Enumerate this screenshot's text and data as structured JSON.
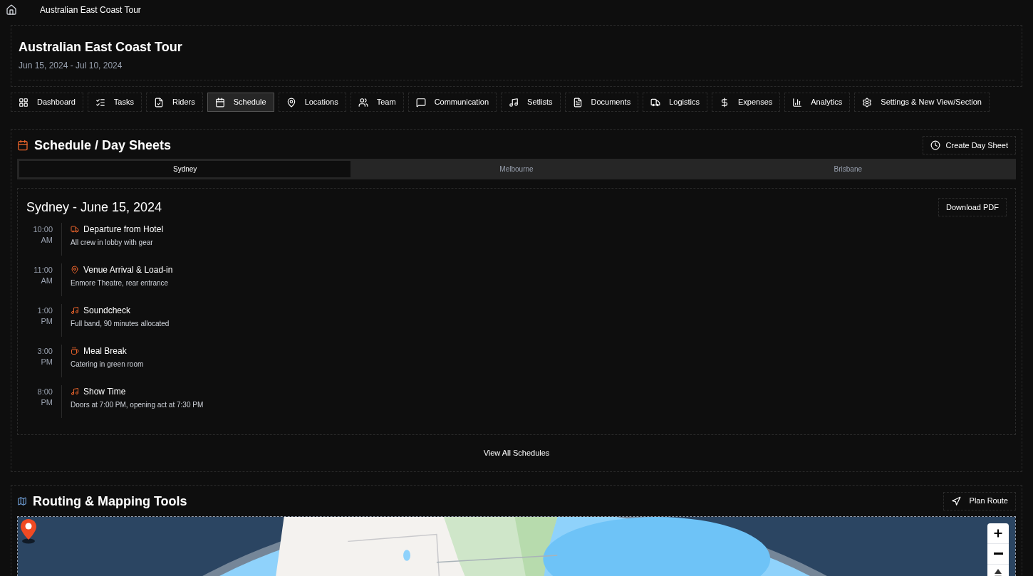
{
  "breadcrumb": {
    "title": "Australian East Coast Tour"
  },
  "header": {
    "title": "Australian East Coast Tour",
    "dates": "Jun 15, 2024 - Jul 10, 2024"
  },
  "nav_tabs": [
    {
      "label": "Dashboard",
      "selected": false
    },
    {
      "label": "Tasks",
      "selected": false
    },
    {
      "label": "Riders",
      "selected": false
    },
    {
      "label": "Schedule",
      "selected": true
    },
    {
      "label": "Locations",
      "selected": false
    },
    {
      "label": "Team",
      "selected": false
    },
    {
      "label": "Communication",
      "selected": false
    },
    {
      "label": "Setlists",
      "selected": false
    },
    {
      "label": "Documents",
      "selected": false
    },
    {
      "label": "Logistics",
      "selected": false
    },
    {
      "label": "Expenses",
      "selected": false
    },
    {
      "label": "Analytics",
      "selected": false
    },
    {
      "label": "Settings & New View/Section",
      "selected": false
    }
  ],
  "schedule": {
    "title": "Schedule / Day Sheets",
    "create_button": "Create Day Sheet",
    "city_tabs": [
      {
        "label": "Sydney",
        "selected": true
      },
      {
        "label": "Melbourne",
        "selected": false
      },
      {
        "label": "Brisbane",
        "selected": false
      }
    ],
    "day_sheet": {
      "title": "Sydney - June 15, 2024",
      "download_button": "Download PDF",
      "events": [
        {
          "time": "10:00",
          "period": "AM",
          "kind": "travel",
          "title": "Departure from Hotel",
          "note": "All crew in lobby with gear"
        },
        {
          "time": "11:00",
          "period": "AM",
          "kind": "venue",
          "title": "Venue Arrival & Load-in",
          "note": "Enmore Theatre, rear entrance"
        },
        {
          "time": "1:00",
          "period": "PM",
          "kind": "music",
          "title": "Soundcheck",
          "note": "Full band, 90 minutes allocated"
        },
        {
          "time": "3:00",
          "period": "PM",
          "kind": "meal",
          "title": "Meal Break",
          "note": "Catering in green room"
        },
        {
          "time": "8:00",
          "period": "PM",
          "kind": "music",
          "title": "Show Time",
          "note": "Doors at 7:00 PM, opening act at 7:30 PM"
        }
      ]
    },
    "view_all": "View All Schedules"
  },
  "routing": {
    "title": "Routing & Mapping Tools",
    "plan_button": "Plan Route"
  }
}
